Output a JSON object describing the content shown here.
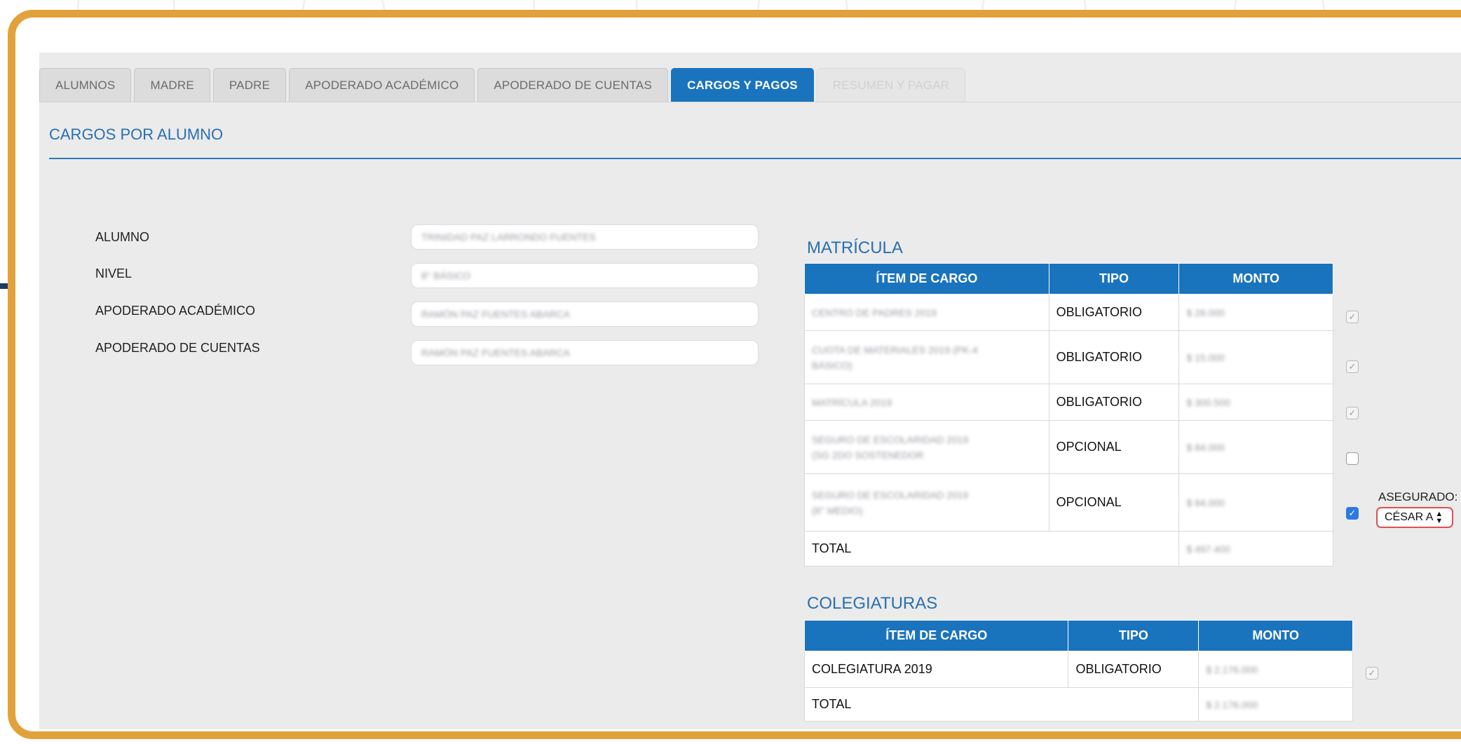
{
  "tabs": [
    {
      "label": "ALUMNOS",
      "state": "normal"
    },
    {
      "label": "MADRE",
      "state": "normal"
    },
    {
      "label": "PADRE",
      "state": "normal"
    },
    {
      "label": "APODERADO ACADÉMICO",
      "state": "normal"
    },
    {
      "label": "APODERADO DE CUENTAS",
      "state": "normal"
    },
    {
      "label": "CARGOS Y PAGOS",
      "state": "active"
    },
    {
      "label": "RESUMEN Y PAGAR",
      "state": "disabled"
    }
  ],
  "section_title": "CARGOS POR ALUMNO",
  "student_info": {
    "rows": [
      {
        "label": "ALUMNO",
        "value": "TRINIDAD PAZ LARRONDO FUENTES"
      },
      {
        "label": "NIVEL",
        "value": "8° BÁSICO"
      },
      {
        "label": "APODERADO ACADÉMICO",
        "value": "RAMÓN PAZ FUENTES ABARCA"
      },
      {
        "label": "APODERADO DE CUENTAS",
        "value": "RAMÓN PAZ FUENTES ABARCA"
      }
    ]
  },
  "matricula": {
    "title": "MATRÍCULA",
    "headers": [
      "ÍTEM DE CARGO",
      "TIPO",
      "MONTO"
    ],
    "rows": [
      {
        "item": "CENTRO DE PADRES 2019",
        "tipo": "OBLIGATORIO",
        "monto": "$ 28.000",
        "checkbox": "disabled-checked"
      },
      {
        "item": "CUOTA DE MATERIALES 2019 (PK-4 BÁSICO)",
        "tipo": "OBLIGATORIO",
        "monto": "$ 15.000",
        "checkbox": "disabled-checked"
      },
      {
        "item": "MATRÍCULA 2019",
        "tipo": "OBLIGATORIO",
        "monto": "$ 300.500",
        "checkbox": "disabled-checked"
      },
      {
        "item": "SEGURO DE ESCOLARIDAD 2019 (SG 2DO SOSTENEDOR",
        "tipo": "OPCIONAL",
        "monto": "$ 84.000",
        "checkbox": "unchecked"
      },
      {
        "item": "SEGURO DE ESCOLARIDAD 2019 (8° MEDIO)",
        "tipo": "OPCIONAL",
        "monto": "$ 84.000",
        "checkbox": "checked"
      }
    ],
    "total_label": "TOTAL",
    "total_value": "$ 497.400",
    "asegurado_label": "ASEGURADO:",
    "asegurado_selected": "CÉSAR A"
  },
  "colegiaturas": {
    "title": "COLEGIATURAS",
    "headers": [
      "ÍTEM DE CARGO",
      "TIPO",
      "MONTO"
    ],
    "rows": [
      {
        "item": "COLEGIATURA 2019",
        "tipo": "OBLIGATORIO",
        "monto": "$ 2.176.000",
        "checkbox": "disabled-checked"
      }
    ],
    "total_label": "TOTAL",
    "total_value": "$ 2.176.000"
  },
  "colors": {
    "accent": "#1a73bd",
    "frame": "#e2a23b",
    "title_blue": "#2a6fb0",
    "checkbox_on": "#2c7ae0",
    "select_border": "#e05050"
  }
}
